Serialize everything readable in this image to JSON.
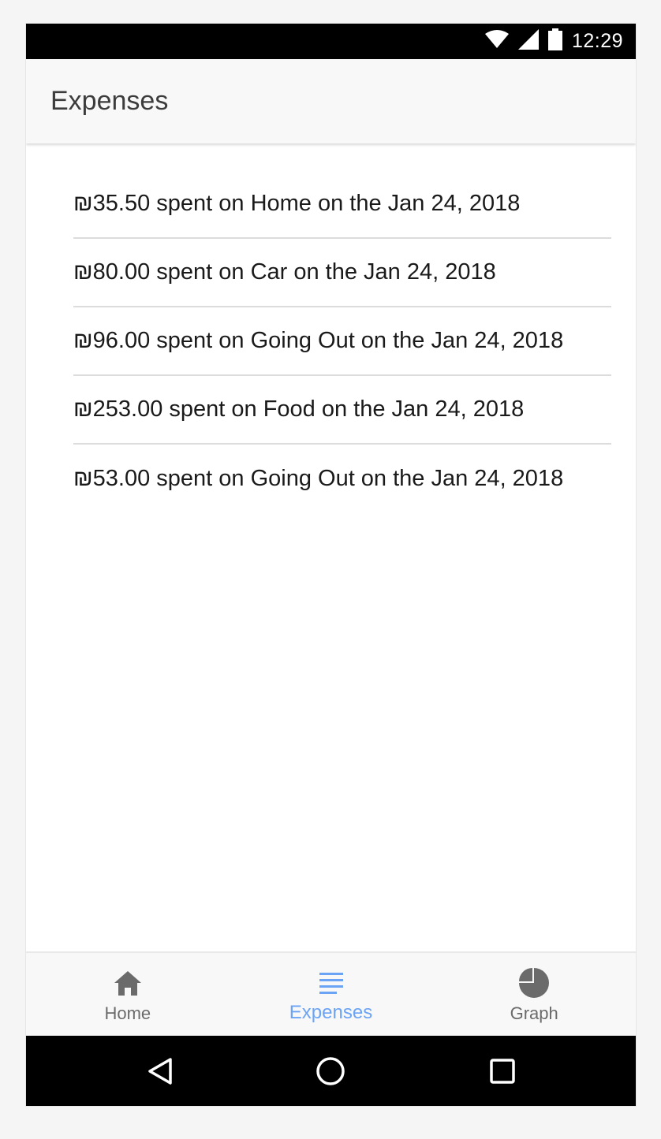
{
  "status_bar": {
    "time": "12:29",
    "icons": [
      "wifi-icon",
      "cell-signal-icon",
      "battery-icon"
    ]
  },
  "app_bar": {
    "title": "Expenses"
  },
  "expenses": [
    {
      "text": "₪35.50 spent on Home on the Jan 24, 2018"
    },
    {
      "text": "₪80.00 spent on Car on the Jan 24, 2018"
    },
    {
      "text": "₪96.00 spent on Going Out on the Jan 24, 2018"
    },
    {
      "text": "₪253.00 spent on Food on the Jan 24, 2018"
    },
    {
      "text": "₪53.00 spent on Going Out on the Jan 24, 2018"
    }
  ],
  "bottom_nav": {
    "items": [
      {
        "label": "Home",
        "icon": "home-icon",
        "active": false
      },
      {
        "label": "Expenses",
        "icon": "list-icon",
        "active": true
      },
      {
        "label": "Graph",
        "icon": "pie-chart-icon",
        "active": false
      }
    ]
  },
  "system_nav": {
    "buttons": [
      "back-icon",
      "home-circle-icon",
      "recents-icon"
    ]
  },
  "colors": {
    "accent": "#6ba3f5",
    "inactive": "#6b6b6b",
    "app_bar_bg": "#f8f8f8",
    "divider": "#dcdcdc"
  }
}
